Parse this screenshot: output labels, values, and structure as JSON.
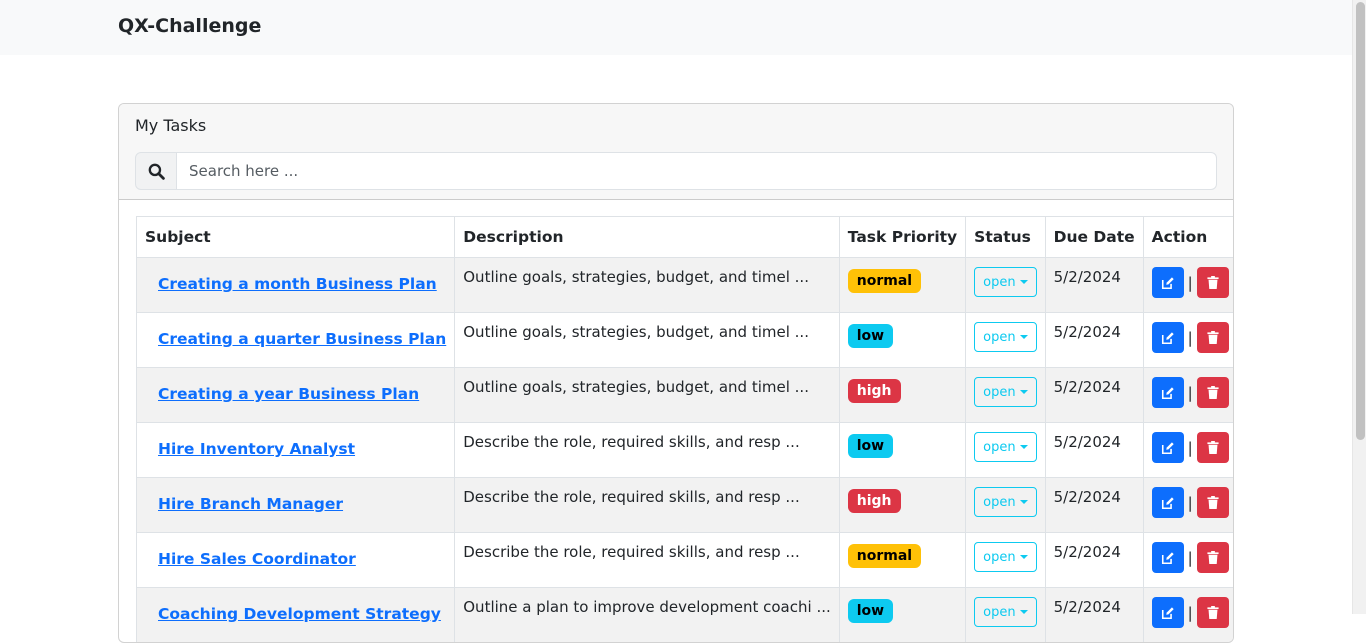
{
  "app": {
    "brand": "QX-Challenge"
  },
  "card": {
    "title": "My Tasks"
  },
  "search": {
    "placeholder": "Search here ..."
  },
  "table": {
    "headers": [
      "Subject",
      "Description",
      "Task Priority",
      "Status",
      "Due Date",
      "Action"
    ],
    "action_separator": "|",
    "rows": [
      {
        "subject": "Creating a month Business Plan",
        "description": "Outline goals, strategies, budget, and timel ...",
        "priority": "normal",
        "status": "open",
        "due": "5/2/2024"
      },
      {
        "subject": "Creating a quarter Business Plan",
        "description": "Outline goals, strategies, budget, and timel ...",
        "priority": "low",
        "status": "open",
        "due": "5/2/2024"
      },
      {
        "subject": "Creating a year Business Plan",
        "description": "Outline goals, strategies, budget, and timel ...",
        "priority": "high",
        "status": "open",
        "due": "5/2/2024"
      },
      {
        "subject": "Hire Inventory Analyst",
        "description": "Describe the role, required skills, and resp ...",
        "priority": "low",
        "status": "open",
        "due": "5/2/2024"
      },
      {
        "subject": "Hire Branch Manager",
        "description": "Describe the role, required skills, and resp ...",
        "priority": "high",
        "status": "open",
        "due": "5/2/2024"
      },
      {
        "subject": "Hire Sales Coordinator",
        "description": "Describe the role, required skills, and resp ...",
        "priority": "normal",
        "status": "open",
        "due": "5/2/2024"
      },
      {
        "subject": "Coaching Development Strategy",
        "description": "Outline a plan to improve development coachi ...",
        "priority": "low",
        "status": "open",
        "due": "5/2/2024"
      }
    ]
  },
  "colors": {
    "primary": "#0d6efd",
    "danger": "#dc3545",
    "warning": "#ffc107",
    "info": "#0dcaf0"
  },
  "icons": {
    "search": "search-icon",
    "edit": "edit-icon",
    "delete": "trash-icon"
  }
}
